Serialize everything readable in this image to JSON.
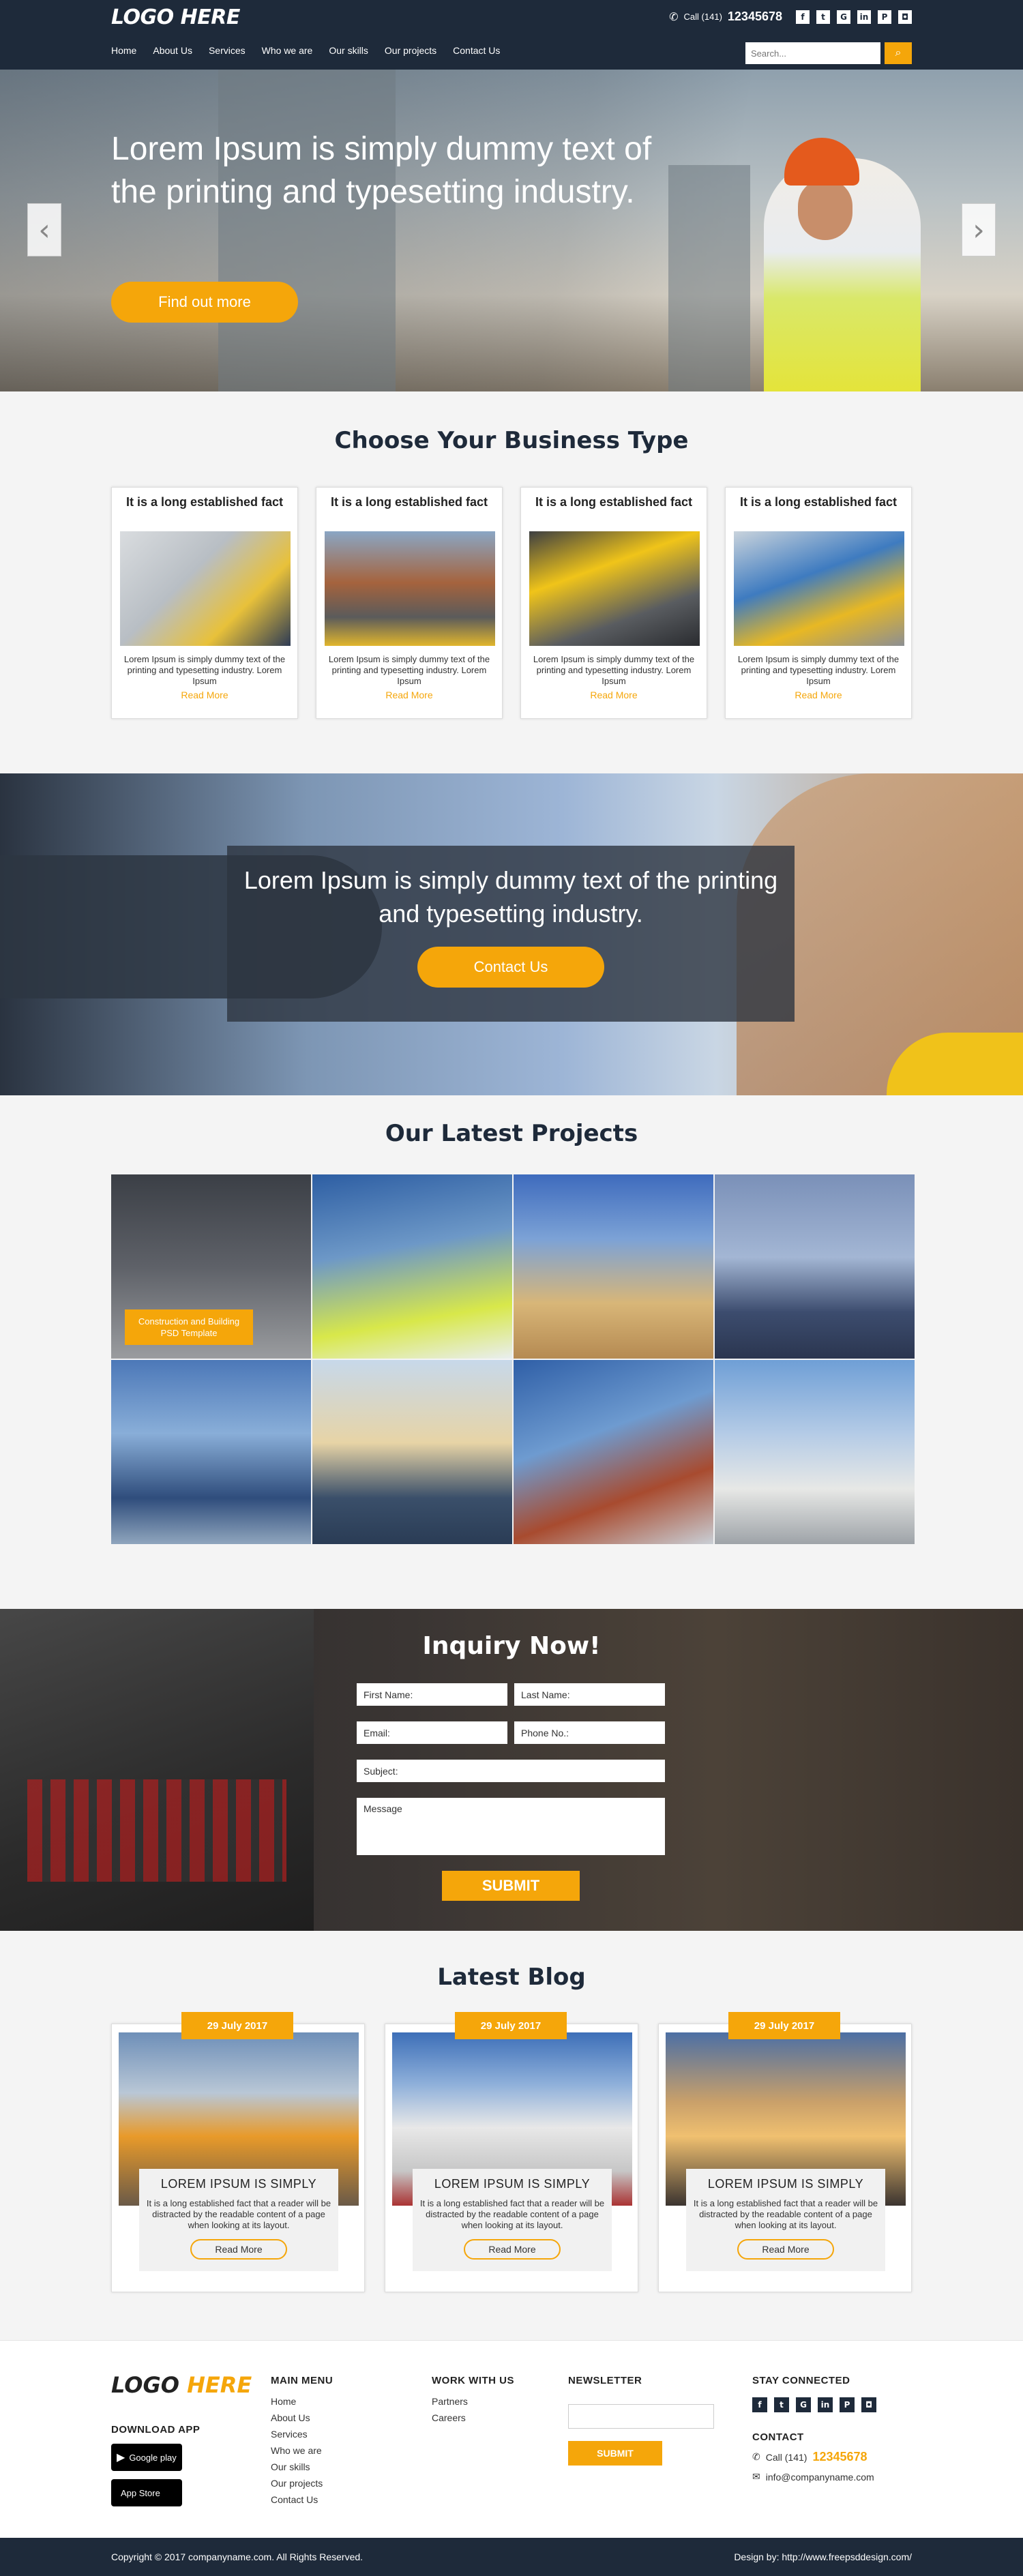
{
  "header": {
    "logo": "LOGO HERE",
    "phone_prefix": "Call (141)",
    "phone_number": "12345678",
    "social": [
      {
        "name": "facebook-icon",
        "glyph": "f"
      },
      {
        "name": "twitter-icon",
        "glyph": "t"
      },
      {
        "name": "google-plus-icon",
        "glyph": "G"
      },
      {
        "name": "linkedin-icon",
        "glyph": "in"
      },
      {
        "name": "pinterest-icon",
        "glyph": "P"
      },
      {
        "name": "instagram-icon",
        "glyph": "◘"
      }
    ],
    "nav": [
      "Home",
      "About Us",
      "Services",
      "Who we are",
      "Our skills",
      "Our projects",
      "Contact Us"
    ],
    "search_placeholder": "Search..."
  },
  "hero": {
    "title": "Lorem Ipsum is simply dummy text of the printing and typesetting industry.",
    "button": "Find out more"
  },
  "business": {
    "title": "Choose Your Business Type",
    "cards": [
      {
        "title": "It is a long established fact",
        "text": "Lorem Ipsum is simply dummy text of the printing and typesetting industry. Lorem Ipsum",
        "link": "Read More"
      },
      {
        "title": "It is a long established fact",
        "text": "Lorem Ipsum is simply dummy text of the printing and typesetting industry. Lorem Ipsum",
        "link": "Read More"
      },
      {
        "title": "It is a long established fact",
        "text": "Lorem Ipsum is simply dummy text of the printing and typesetting industry. Lorem Ipsum",
        "link": "Read More"
      },
      {
        "title": "It is a long established fact",
        "text": "Lorem Ipsum is simply dummy text of the printing and typesetting industry. Lorem Ipsum",
        "link": "Read More"
      }
    ]
  },
  "banner": {
    "title": "Lorem Ipsum is simply dummy text of the printing and typesetting industry.",
    "button": "Contact Us"
  },
  "projects": {
    "title": "Our Latest Projects",
    "overlay_label": "Construction and Building PSD Template"
  },
  "inquiry": {
    "title": "Inquiry Now!",
    "first_name": "First Name:",
    "last_name": "Last Name:",
    "email": "Email:",
    "phone": "Phone No.:",
    "subject": "Subject:",
    "message": "Message",
    "submit": "SUBMIT"
  },
  "blog": {
    "title": "Latest Blog",
    "posts": [
      {
        "date": "29 July 2017",
        "title": "LOREM IPSUM IS SIMPLY",
        "text": "It is a long established fact that a reader will be distracted by the readable content of a page when looking at its layout.",
        "button": "Read More"
      },
      {
        "date": "29 July 2017",
        "title": "LOREM IPSUM IS SIMPLY",
        "text": "It is a long established fact that a reader will be distracted by the readable content of a page when looking at its layout.",
        "button": "Read More"
      },
      {
        "date": "29 July 2017",
        "title": "LOREM IPSUM IS SIMPLY",
        "text": "It is a long established fact that a reader will be distracted by the readable content of a page when looking at its layout.",
        "button": "Read More"
      }
    ]
  },
  "footer": {
    "logo_main": "LOGO",
    "logo_accent": "HERE",
    "download_app": "DOWNLOAD APP",
    "google_play": "Google play",
    "app_store": "App Store",
    "main_menu_title": "MAIN MENU",
    "main_menu": [
      "Home",
      "About Us",
      "Services",
      "Who we are",
      "Our skills",
      "Our projects",
      "Contact Us"
    ],
    "work_title": "WORK WITH US",
    "work_items": [
      "Partners",
      "Careers"
    ],
    "newsletter_title": "NEWSLETTER",
    "newsletter_submit": "SUBMIT",
    "stay_title": "STAY CONNECTED",
    "contact_title": "CONTACT",
    "contact_prefix": "Call (141)",
    "contact_number": "12345678",
    "contact_email": "info@companyname.com"
  },
  "copyright": {
    "left": "Copyright © 2017 companyname.com. All Rights Reserved.",
    "right": "Design by: http://www.freepsddesign.com/"
  },
  "colors": {
    "accent": "#f5a60a",
    "navy": "#1e2a3a"
  }
}
